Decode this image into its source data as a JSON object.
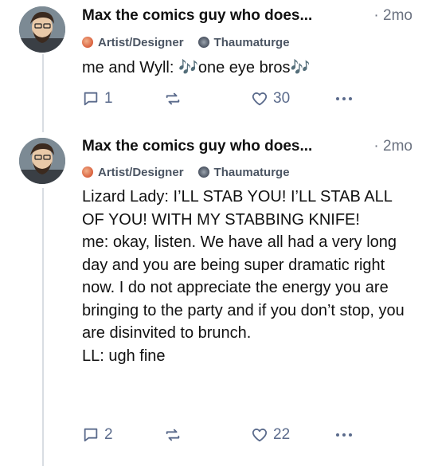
{
  "posts": [
    {
      "author": "Max the comics guy who does...",
      "time": "· 2mo",
      "badges": [
        "Artist/Designer",
        "Thaumaturge"
      ],
      "body": "me and Wyll: 🎶one eye bros🎶",
      "replies": "1",
      "likes": "30"
    },
    {
      "author": "Max the comics guy who does...",
      "time": "· 2mo",
      "badges": [
        "Artist/Designer",
        "Thaumaturge"
      ],
      "body": "Lizard Lady: I’LL STAB YOU! I’LL STAB ALL OF YOU! WITH MY STABBING KNIFE!\nme: okay, listen. We have all had a very long day and you are being super dramatic right now. I do not appreciate the energy you are bringing to the party and if you don’t stop, you are disinvited to brunch.\nLL: ugh fine",
      "replies": "2",
      "likes": "22"
    }
  ],
  "icons": {
    "reply": "speech-bubble-icon",
    "repost": "repost-arrows-icon",
    "like": "heart-icon",
    "more": "ellipsis-icon"
  },
  "colors": {
    "action": "#5b6b8c",
    "muted": "#6b7280",
    "thread": "#d9dde3"
  }
}
